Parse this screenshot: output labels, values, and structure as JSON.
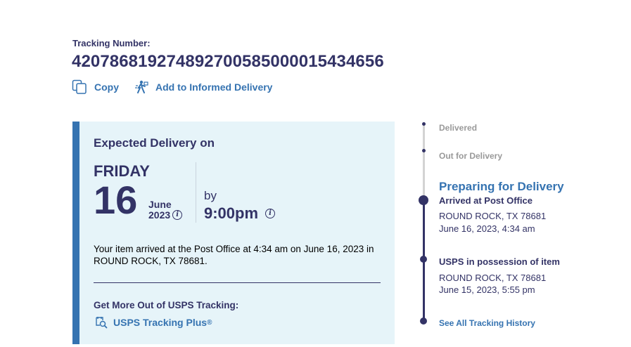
{
  "tracking": {
    "label": "Tracking Number:",
    "number": "420786819274892700585000015434656"
  },
  "actions": {
    "copy_label": "Copy",
    "informed_delivery_label": "Add to Informed Delivery"
  },
  "expected": {
    "title": "Expected Delivery on",
    "day": "FRIDAY",
    "date": "16",
    "month": "June",
    "year": "2023",
    "by_label": "by",
    "time": "9:00pm",
    "info_glyph": "i",
    "status_text": "Your item arrived at the Post Office at 4:34 am on June 16, 2023 in ROUND ROCK, TX 78681.",
    "more_title": "Get More Out of USPS Tracking:",
    "plus_label": "USPS Tracking Plus",
    "plus_mark": "®"
  },
  "timeline": {
    "steps": [
      {
        "label": "Delivered"
      },
      {
        "label": "Out for Delivery"
      },
      {
        "label": "Preparing for Delivery"
      }
    ],
    "events": [
      {
        "title": "Arrived at Post Office",
        "location": "ROUND ROCK, TX 78681",
        "datetime": "June 16, 2023, 4:34 am"
      },
      {
        "title": "USPS in possession of item",
        "location": "ROUND ROCK, TX 78681",
        "datetime": "June 15, 2023, 5:55 pm"
      }
    ],
    "history_link": "See All Tracking History"
  },
  "colors": {
    "navy": "#333366",
    "link_blue": "#3573b1",
    "card_bg": "#e6f4f9",
    "inactive_gray": "#999999",
    "inactive_line": "#d3d3d3"
  },
  "icons": {
    "copy": "copy-icon",
    "informed_delivery": "mail-carrier-icon",
    "tracking_plus": "tracking-plus-icon",
    "info": "info-icon"
  }
}
